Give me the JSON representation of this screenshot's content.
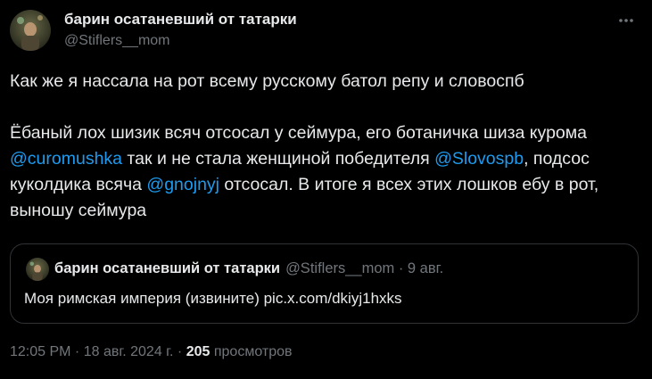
{
  "author": {
    "name": "барин осатаневший от татарки",
    "handle": "@Stiflers__mom"
  },
  "tweet": {
    "line1": "Как же я нассала на рот всему русскому батол репу и словоспб",
    "p2_part1": "Ёбаный лох шизик всяч отсосал у сеймура, его ботаничка шиза курома ",
    "mention1": "@curomushka",
    "p2_part2": " так и не стала женщиной победителя ",
    "mention2": "@Slovospb",
    "p2_part3": ", подсос куколдика всячa ",
    "mention3": "@gnojnyj",
    "p2_part4": " отсосал. В итоге я всех этих лошков ебу в рот, выношу сеймура"
  },
  "quote": {
    "name": "барин осатаневший от татарки",
    "meta": "@Stiflers__mom · 9 авг.",
    "text": "Моя римская империя (извините) pic.x.com/dkiyj1hxks"
  },
  "footer": {
    "time": "12:05 PM · 18 авг. 2024 г.",
    "separator": " · ",
    "views_count": "205",
    "views_label": " просмотров"
  },
  "icons": {
    "more": "more-horizontal-icon"
  },
  "colors": {
    "background": "#000000",
    "text": "#e7e9ea",
    "secondary": "#71767b",
    "accent": "#1d9bf0",
    "border": "#2f3336"
  }
}
